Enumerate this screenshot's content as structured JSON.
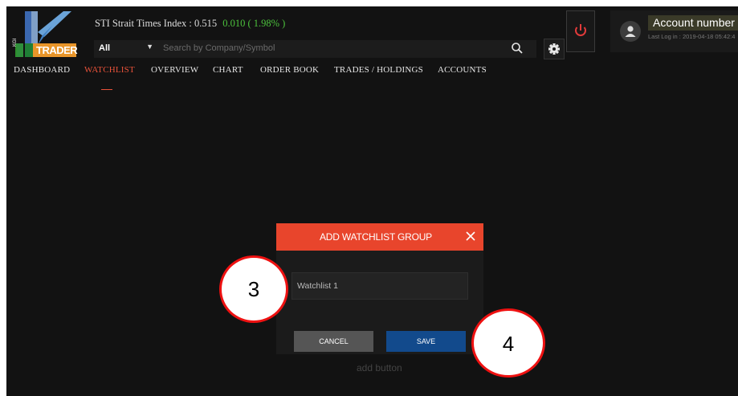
{
  "brand": {
    "logo_letters": "K",
    "logo_side": "KGI",
    "logo_word": "TRADER"
  },
  "ticker": {
    "label": "STI Strait Times Index :",
    "value": "0.515",
    "change": "0.010 ( 1.98% )",
    "change_color": "#4cc23c"
  },
  "search": {
    "filter_value": "All",
    "placeholder": "Search by Company/Symbol",
    "icon": "search-icon"
  },
  "user": {
    "account_label": "Account number",
    "last_log": "Last Log in : 2019-04-18 05:42:4"
  },
  "nav": {
    "items": [
      {
        "label": "DASHBOARD"
      },
      {
        "label": "WATCHLIST",
        "active": true
      },
      {
        "label": "OVERVIEW"
      },
      {
        "label": "CHART"
      },
      {
        "label": "ORDER BOOK"
      },
      {
        "label": "TRADES / HOLDINGS"
      },
      {
        "label": "ACCOUNTS"
      }
    ],
    "active_color": "#e8523a"
  },
  "main": {
    "hint": "add button"
  },
  "modal": {
    "title": "ADD WATCHLIST GROUP",
    "input_value": "Watchlist 1",
    "cancel_label": "CANCEL",
    "save_label": "SAVE",
    "header_color": "#e8452c",
    "save_color": "#124a8c"
  },
  "callouts": {
    "first": "3",
    "second": "4"
  }
}
